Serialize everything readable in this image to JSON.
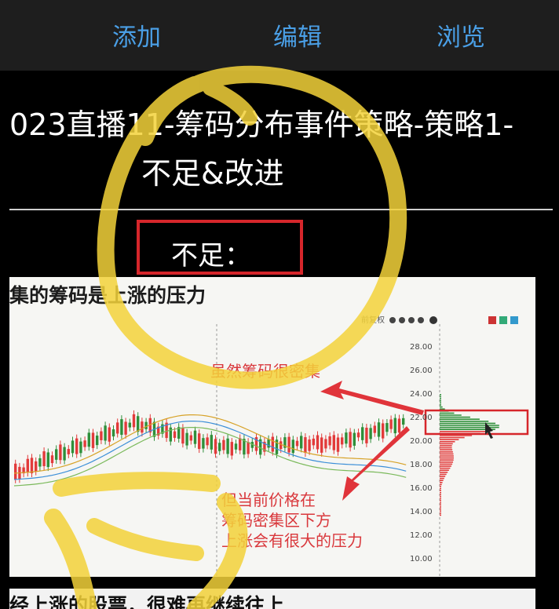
{
  "toolbar": {
    "tabs": [
      {
        "label": "添加"
      },
      {
        "label": "编辑"
      },
      {
        "label": "浏览"
      }
    ]
  },
  "note": {
    "title_line1": "023直播11-筹码分布事件策略-策略1-",
    "title_line2": "不足&改进",
    "section_label": "不足："
  },
  "screenshot": {
    "title": "集的筹码是上涨的压力",
    "annotation_top": "虽然筹码很密集",
    "annotation_bottom": [
      "但当前价格在",
      "筹码密集区下方",
      "上涨会有很大的压力"
    ],
    "price_ticks": [
      "28.00",
      "26.00",
      "24.00",
      "22.00",
      "20.00",
      "18.00",
      "16.00",
      "14.00",
      "12.00",
      "10.00"
    ],
    "toolbar_label": "前复权",
    "colors": {
      "highlight_box": "#d6262b",
      "arrow": "#e0343a",
      "up_candle": "#e23b3b",
      "down_candle": "#2f8f3a",
      "marker": "#f0d020"
    }
  },
  "screenshot2": {
    "title": "经上涨的股票，很难再继续往上"
  }
}
